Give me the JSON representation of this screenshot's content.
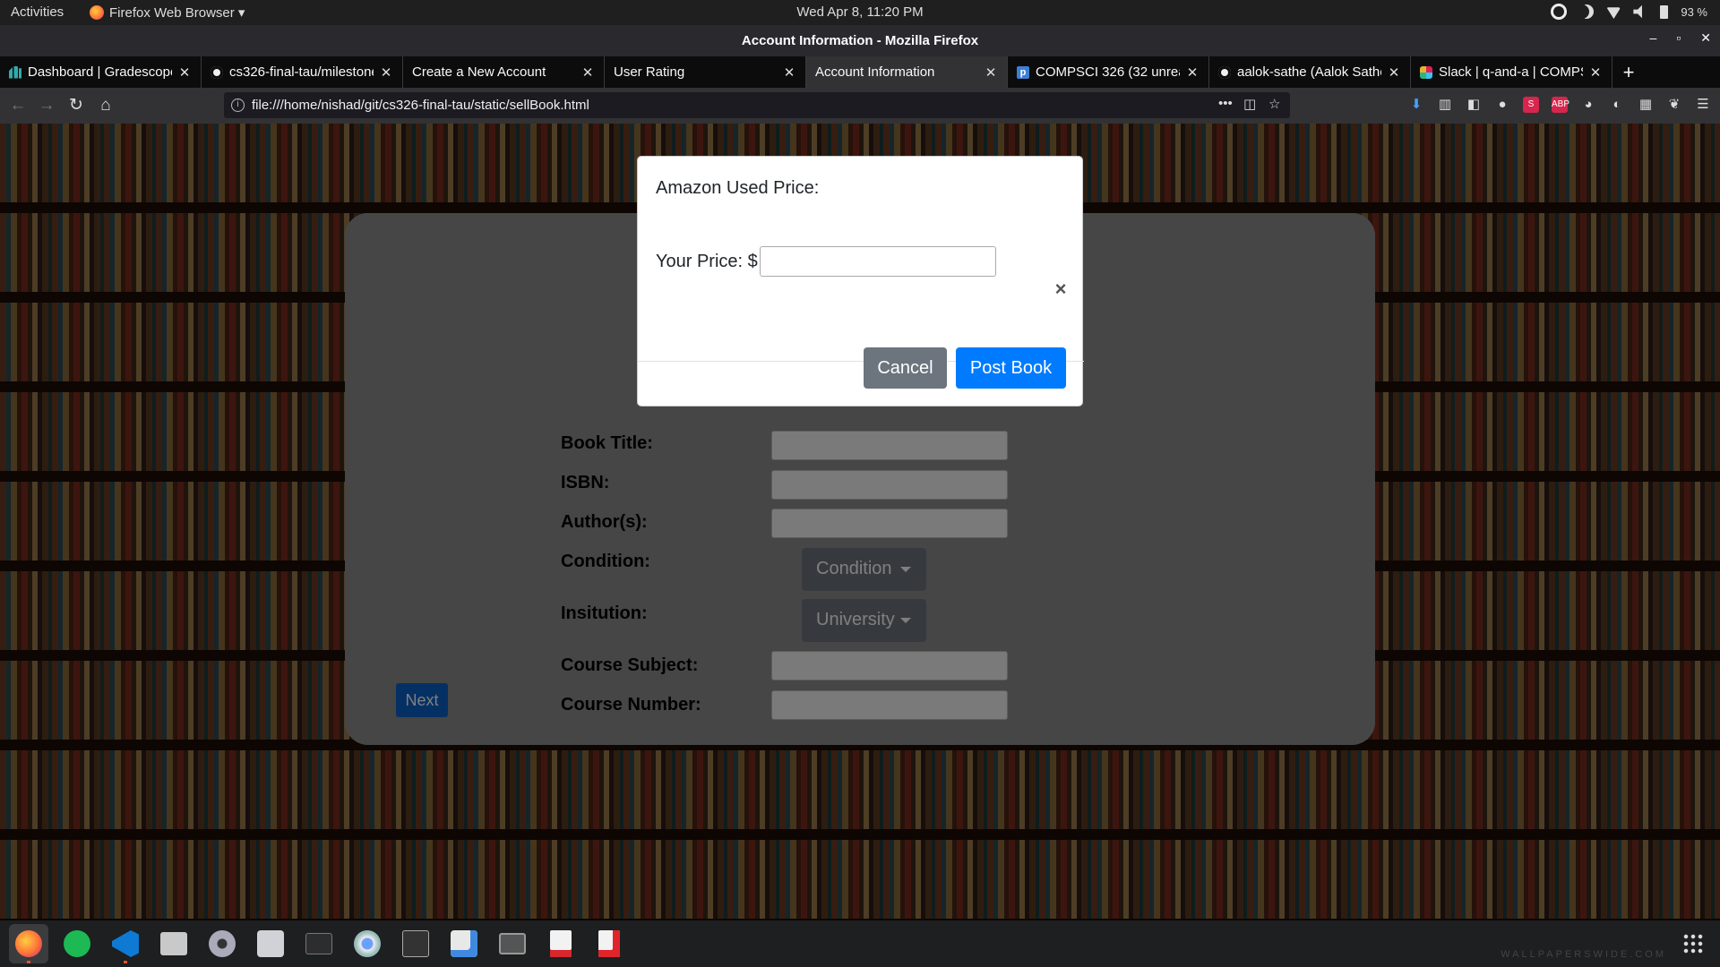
{
  "system_bar": {
    "activities": "Activities",
    "app_menu": "Firefox Web Browser ▾",
    "clock": "Wed Apr  8, 11:20 PM",
    "battery": "93 %"
  },
  "window": {
    "title": "Account Information - Mozilla Firefox"
  },
  "tabs": [
    {
      "label": "Dashboard | Gradescope",
      "icon": "gradescope-icon"
    },
    {
      "label": "cs326-final-tau/milestone",
      "icon": "github-icon"
    },
    {
      "label": "Create a New Account",
      "icon": ""
    },
    {
      "label": "User Rating",
      "icon": ""
    },
    {
      "label": "Account Information",
      "icon": "",
      "active": true
    },
    {
      "label": "COMPSCI 326 (32 unread",
      "icon": "piazza-icon"
    },
    {
      "label": "aalok-sathe (Aalok Sathe",
      "icon": "github-icon"
    },
    {
      "label": "Slack | q-and-a | COMPSC",
      "icon": "slack-icon"
    }
  ],
  "address_bar": {
    "url": "file:///home/nishad/git/cs326-final-tau/static/sellBook.html"
  },
  "form": {
    "book_title_label": "Book Title:",
    "isbn_label": "ISBN:",
    "authors_label": "Author(s):",
    "condition_label": "Condition:",
    "condition_button": "Condition",
    "institution_label": "Insitution:",
    "institution_button": "University",
    "course_subject_label": "Course Subject:",
    "course_number_label": "Course Number:",
    "next_button": "Next"
  },
  "modal": {
    "amazon_price_label": "Amazon Used Price:",
    "your_price_label": "Your Price: $",
    "price_value": "",
    "close_glyph": "×",
    "cancel_button": "Cancel",
    "post_button": "Post Book"
  },
  "dock": {
    "apps": [
      "firefox-icon",
      "spotify-icon",
      "vscode-icon",
      "files-icon",
      "settings-icon",
      "tweaks-icon",
      "terminal-icon",
      "chromium-icon",
      "system-monitor-icon",
      "software-center-icon",
      "screenshot-icon",
      "document-viewer-icon",
      "text-editor-icon"
    ],
    "watermark": "WALLPAPERSWIDE.COM"
  },
  "colors": {
    "primary": "#007bff",
    "secondary": "#6c757d",
    "card": "#8d8d8d"
  }
}
